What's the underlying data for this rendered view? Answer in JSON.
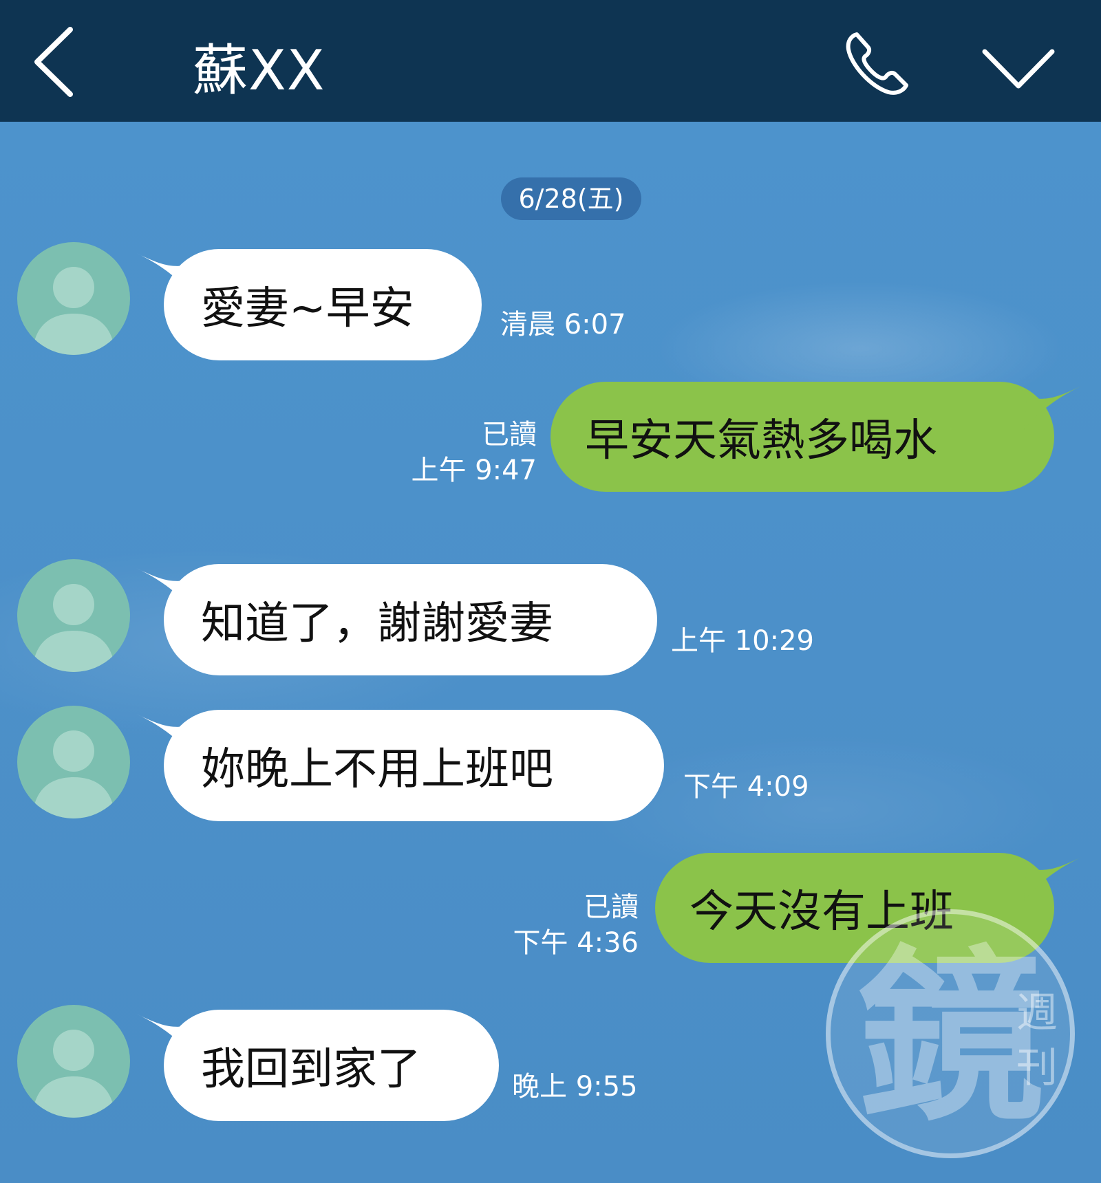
{
  "header": {
    "contact_name": "蘇XX",
    "back_icon": "back-chevron-icon",
    "call_icon": "phone-icon",
    "menu_icon": "chevron-down-icon"
  },
  "date_separator": "6/28(五)",
  "messages": [
    {
      "direction": "incoming",
      "text": "愛妻~早安",
      "time": "清晨 6:07"
    },
    {
      "direction": "outgoing",
      "text": "早安天氣熱多喝水",
      "read": "已讀",
      "time": "上午 9:47"
    },
    {
      "direction": "incoming",
      "text": "知道了，謝謝愛妻",
      "time": "上午 10:29"
    },
    {
      "direction": "incoming",
      "text": "妳晚上不用上班吧",
      "time": "下午 4:09"
    },
    {
      "direction": "outgoing",
      "text": "今天沒有上班",
      "read": "已讀",
      "time": "下午 4:36"
    },
    {
      "direction": "incoming",
      "text": "我回到家了",
      "time": "晚上 9:55"
    }
  ],
  "colors": {
    "header_bg": "#0e3452",
    "chat_bg": "#4a8fc9",
    "incoming_bubble": "#ffffff",
    "outgoing_bubble": "#8bc34a",
    "avatar_bg": "#7cbfb0"
  },
  "watermark": {
    "main": "鏡",
    "side_top": "週",
    "side_bottom": "刊"
  }
}
